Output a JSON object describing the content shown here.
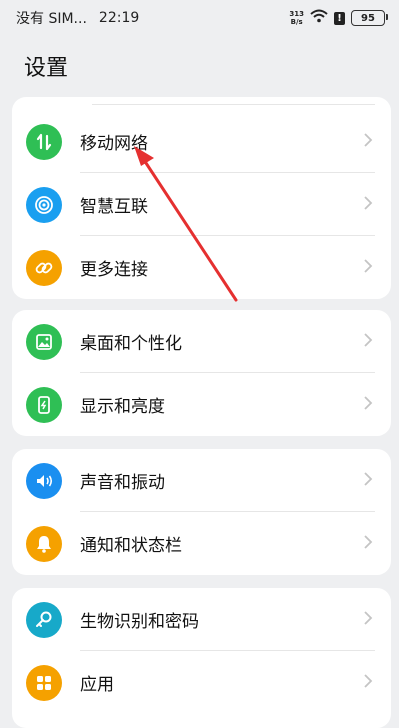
{
  "status_bar": {
    "carrier": "没有 SIM...",
    "time": "22:19",
    "net_speed_value": "313",
    "net_speed_unit": "B/s",
    "alert": "!",
    "battery": "95"
  },
  "header": {
    "title": "设置"
  },
  "groups": [
    {
      "items": [
        {
          "label": "移动网络",
          "icon": "mobile-data-icon",
          "color": "#2fbf55"
        },
        {
          "label": "智慧互联",
          "icon": "smart-connect-icon",
          "color": "#1a9ff0"
        },
        {
          "label": "更多连接",
          "icon": "link-icon",
          "color": "#f5a100"
        }
      ]
    },
    {
      "items": [
        {
          "label": "桌面和个性化",
          "icon": "image-icon",
          "color": "#2fbf55"
        },
        {
          "label": "显示和亮度",
          "icon": "display-icon",
          "color": "#2fbf55"
        }
      ]
    },
    {
      "items": [
        {
          "label": "声音和振动",
          "icon": "speaker-icon",
          "color": "#1a8ff0"
        },
        {
          "label": "通知和状态栏",
          "icon": "bell-icon",
          "color": "#f5a100"
        }
      ]
    },
    {
      "items": [
        {
          "label": "生物识别和密码",
          "icon": "key-icon",
          "color": "#17a9c9"
        },
        {
          "label": "应用",
          "icon": "apps-grid-icon",
          "color": "#f5a100"
        }
      ]
    }
  ],
  "annotation": {
    "color": "#e53030"
  }
}
